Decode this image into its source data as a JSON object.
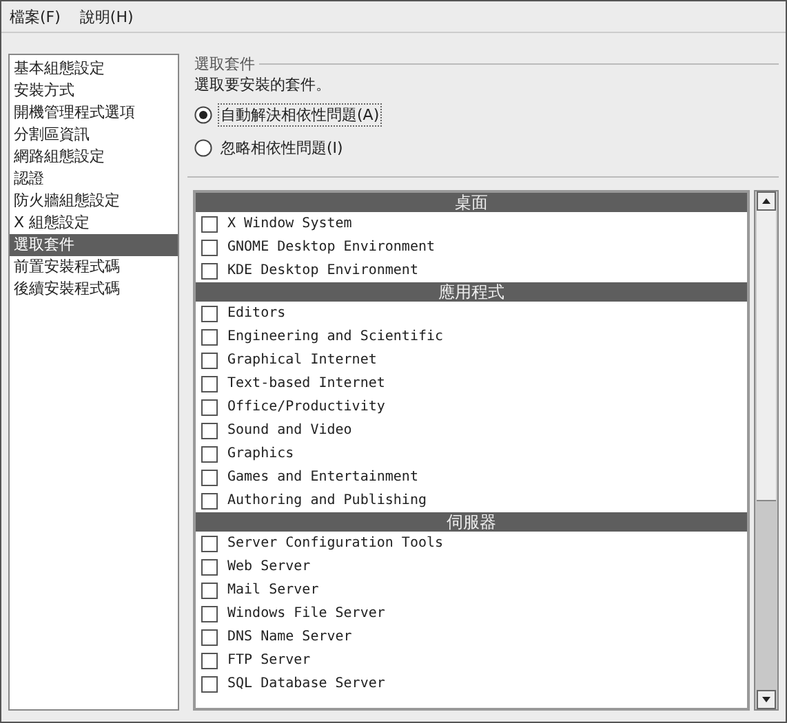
{
  "menu": [
    {
      "label": "檔案(F)"
    },
    {
      "label": "說明(H)"
    }
  ],
  "sidebar": {
    "items": [
      {
        "label": "基本組態設定",
        "selected": false
      },
      {
        "label": "安裝方式",
        "selected": false
      },
      {
        "label": "開機管理程式選項",
        "selected": false
      },
      {
        "label": "分割區資訊",
        "selected": false
      },
      {
        "label": "網路組態設定",
        "selected": false
      },
      {
        "label": "認證",
        "selected": false
      },
      {
        "label": "防火牆組態設定",
        "selected": false
      },
      {
        "label": "X 組態設定",
        "selected": false
      },
      {
        "label": "選取套件",
        "selected": true
      },
      {
        "label": "前置安裝程式碼",
        "selected": false
      },
      {
        "label": "後續安裝程式碼",
        "selected": false
      }
    ]
  },
  "section": {
    "title": "選取套件",
    "description": "選取要安裝的套件。"
  },
  "radios": [
    {
      "label": "自動解決相依性問題(A)",
      "selected": true
    },
    {
      "label": "忽略相依性問題(I)",
      "selected": false
    }
  ],
  "groups": [
    {
      "title": "桌面",
      "packages": [
        {
          "label": "X Window System",
          "checked": false
        },
        {
          "label": "GNOME Desktop Environment",
          "checked": false
        },
        {
          "label": "KDE Desktop Environment",
          "checked": false
        }
      ]
    },
    {
      "title": "應用程式",
      "packages": [
        {
          "label": "Editors",
          "checked": false
        },
        {
          "label": "Engineering and Scientific",
          "checked": false
        },
        {
          "label": "Graphical Internet",
          "checked": false
        },
        {
          "label": "Text-based Internet",
          "checked": false
        },
        {
          "label": "Office/Productivity",
          "checked": false
        },
        {
          "label": "Sound and Video",
          "checked": false
        },
        {
          "label": "Graphics",
          "checked": false
        },
        {
          "label": "Games and Entertainment",
          "checked": false
        },
        {
          "label": "Authoring and Publishing",
          "checked": false
        }
      ]
    },
    {
      "title": "伺服器",
      "packages": [
        {
          "label": "Server Configuration Tools",
          "checked": false
        },
        {
          "label": "Web Server",
          "checked": false
        },
        {
          "label": "Mail Server",
          "checked": false
        },
        {
          "label": "Windows File Server",
          "checked": false
        },
        {
          "label": "DNS Name Server",
          "checked": false
        },
        {
          "label": "FTP Server",
          "checked": false
        },
        {
          "label": "SQL Database Server",
          "checked": false
        }
      ]
    }
  ]
}
